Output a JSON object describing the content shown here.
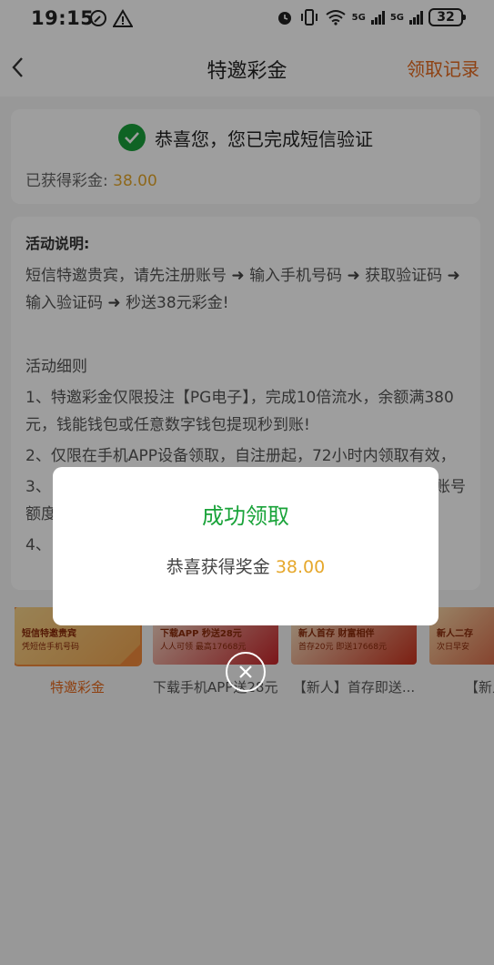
{
  "status_bar": {
    "time": "19:15",
    "network_a": "5G",
    "network_b": "5G",
    "battery": "32"
  },
  "header": {
    "title": "特邀彩金",
    "record_link": "领取记录"
  },
  "verify_card": {
    "message": "恭喜您，您已完成短信验证",
    "earned_label": "已获得彩金: ",
    "earned_amount": "38.00"
  },
  "rules": {
    "heading": "活动说明:",
    "intro_parts": [
      "短信特邀贵宾，请先注册账号",
      "输入手机号码",
      "获取验证码",
      "输入验证码",
      "秒送38元彩金!"
    ],
    "details_heading": "活动细则",
    "item1": "1、特邀彩金仅限投注【PG电子】，完成10倍流水，余额满380元，钱能钱包或任意数字钱包提现秒到账!",
    "item2": "2、仅限在手机APP设备领取，自注册起，72小时内领取有效，",
    "item3_start": "3、",
    "item3_end": "账号",
    "item3_line2": "额度",
    "item4": "4、"
  },
  "promos": [
    {
      "label": "特邀彩金",
      "line1": "短信特邀贵宾",
      "line2": "凭短信手机号码",
      "active": true
    },
    {
      "label": "下载手机APP送28元彩...",
      "line1": "下载APP 秒送28元",
      "line2": "人人可领 最高17668元",
      "active": false
    },
    {
      "label": "【新人】首存即送...",
      "line1": "新人首存 财富相伴",
      "line2": "首存20元 即送17668元",
      "active": false
    },
    {
      "label": "【新人】",
      "line1": "新人二存",
      "line2": "次日早安",
      "active": false
    }
  ],
  "dialog": {
    "title": "成功领取",
    "message_prefix": "恭喜获得奖金 ",
    "amount": "38.00"
  },
  "icons": {
    "back": "chevron-left-icon",
    "check": "check-circle-icon",
    "close": "close-circle-icon",
    "alarm": "alarm-icon",
    "wifi": "wifi-icon",
    "vibrate": "vibrate-icon",
    "warning": "warning-icon",
    "nfc": "nfc-icon"
  },
  "colors": {
    "accent_orange": "#e66a1e",
    "amount_gold": "#e6a82c",
    "success_green": "#1aa33a"
  }
}
